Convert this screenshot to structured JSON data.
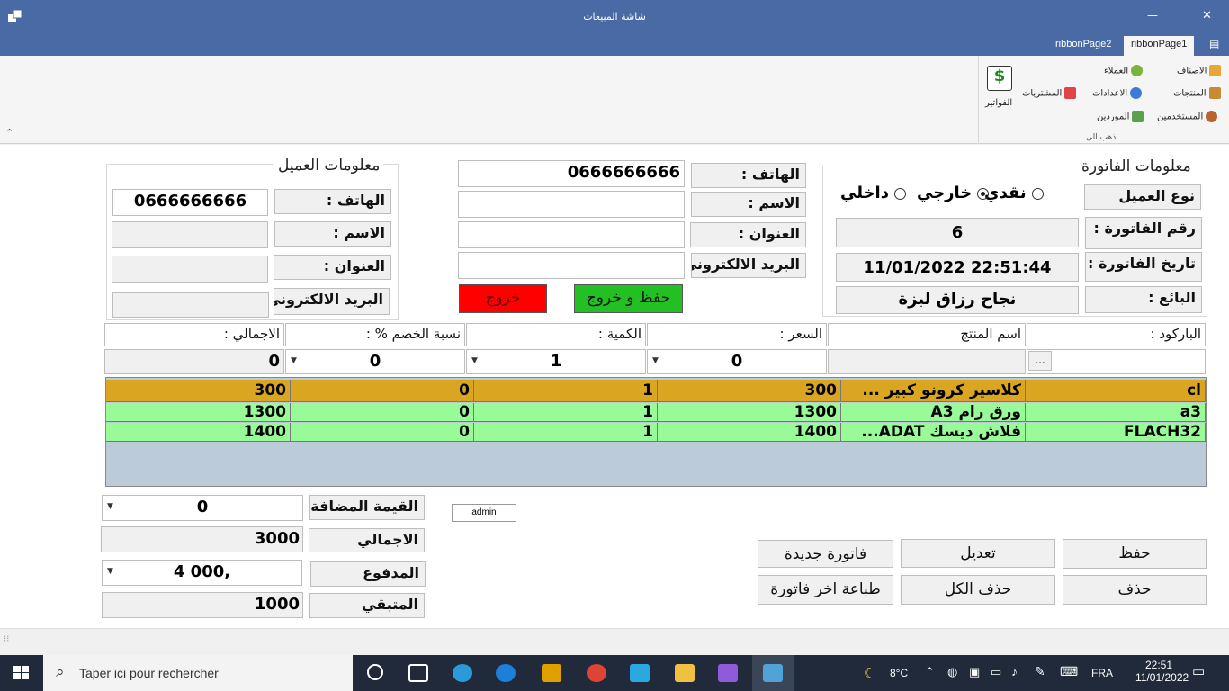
{
  "window": {
    "title": "شاشة المبيعات",
    "minimize": "—",
    "close": "✕"
  },
  "ribbon": {
    "tabs": [
      "ribbonPage1",
      "ribbonPage2"
    ],
    "group_label": "اذهب الى",
    "items": {
      "categories": "الاصناف",
      "customers": "العملاء",
      "products": "المنتجات",
      "settings": "الاعدادات",
      "purchases": "المشتريات",
      "users": "المستخدمين",
      "suppliers": "الموردين",
      "invoices": "الفواتير"
    }
  },
  "invoice_info": {
    "title": "معلومات الفاتورة",
    "customer_type_label": "نوع العميل",
    "customer_type_options": [
      "نقدي",
      "خارجي",
      "داخلي"
    ],
    "customer_type_selected": "نقدي",
    "invoice_number_label": "رقم الفاتورة :",
    "invoice_number": "6",
    "invoice_date_label": "تاريخ الفاتورة :",
    "invoice_date": "11/01/2022  22:51:44",
    "seller_label": "البائع :",
    "seller": "نجاح رزاق لبزة"
  },
  "new_customer": {
    "phone_label": "الهاتف :",
    "phone": "0666666666",
    "name_label": "الاسم :",
    "name": "",
    "address_label": "العنوان :",
    "address": "",
    "email_label": "البريد الالكتروني",
    "email": "",
    "save_exit": "حفظ و خروج",
    "exit": "خروج"
  },
  "customer_info": {
    "title": "معلومات العميل",
    "phone_label": "الهاتف :",
    "phone": "0666666666",
    "name_label": "الاسم :",
    "address_label": "العنوان :",
    "email_label": "البريد الالكتروني"
  },
  "entry": {
    "headers": {
      "barcode": "الباركود :",
      "product_name": "اسم المنتج",
      "price": "السعر :",
      "quantity": "الكمية :",
      "discount": "نسبة الخصم % :",
      "total": "الاجمالي :"
    },
    "barcode": "",
    "browse": "...",
    "product_name": "",
    "price": "0",
    "quantity": "1",
    "discount": "0",
    "total": "0"
  },
  "grid": {
    "rows": [
      {
        "barcode": "cl",
        "name": "كلاسير كرونو كبير ...",
        "price": "300",
        "qty": "1",
        "discount": "0",
        "total": "300",
        "color": "#daa520"
      },
      {
        "barcode": "a3",
        "name": "ورق رام A3",
        "price": "1300",
        "qty": "1",
        "discount": "0",
        "total": "1300",
        "color": "#98fb98"
      },
      {
        "barcode": "FLACH32",
        "name": "فلاش ديسك ADAT...",
        "price": "1400",
        "qty": "1",
        "discount": "0",
        "total": "1400",
        "color": "#98fb98"
      }
    ]
  },
  "totals": {
    "vat_label": "القيمة المضافة",
    "vat": "0",
    "total_label": "الاجمالي",
    "total": "3000",
    "paid_label": "المدفوع",
    "paid": "4 000,",
    "remaining_label": "المتبقي",
    "remaining": "1000"
  },
  "user": "admin",
  "actions": {
    "save": "حفظ",
    "edit": "تعديل",
    "new_invoice": "فاتورة جديدة",
    "delete": "حذف",
    "delete_all": "حذف الكل",
    "print_last": "طباعة اخر فاتورة"
  },
  "taskbar": {
    "search_placeholder": "Taper ici pour rechercher",
    "temperature": "8°C",
    "language": "FRA",
    "time": "22:51",
    "date": "11/01/2022"
  },
  "colors": {
    "accent": "#4a6aa5",
    "row_selected": "#daa520",
    "row_normal": "#98fb98",
    "save_exit": "#22c022",
    "exit": "#ff0000"
  }
}
